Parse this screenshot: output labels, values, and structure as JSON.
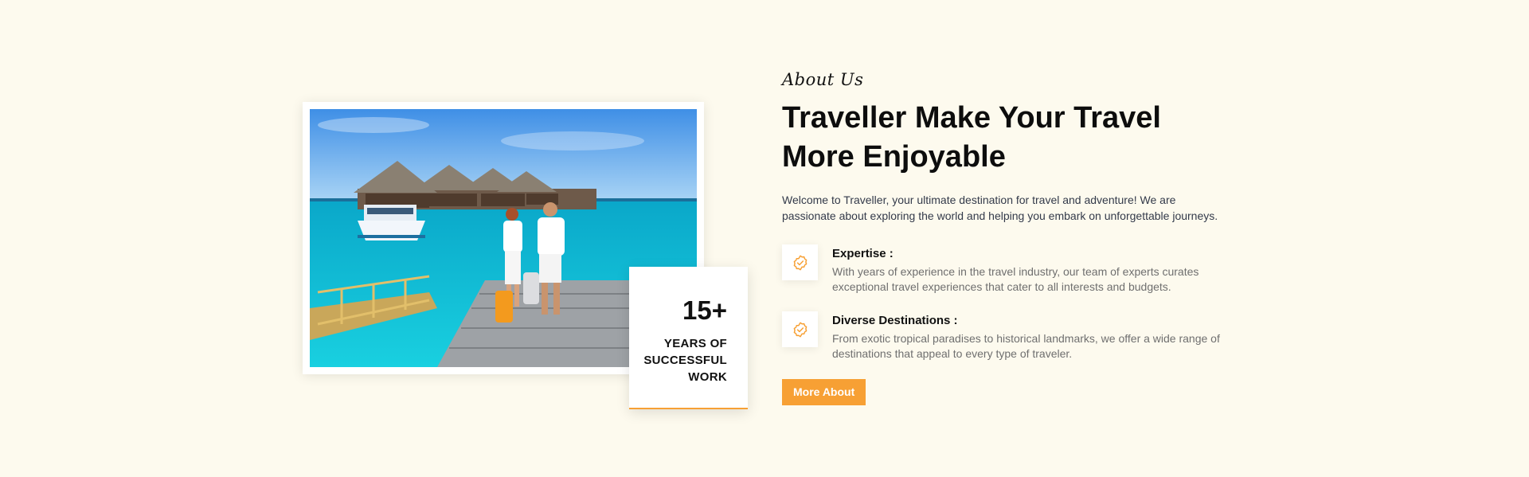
{
  "about": {
    "eyebrow": "About Us",
    "heading": "Traveller Make Your Travel More Enjoyable",
    "intro": "Welcome to Traveller, your ultimate destination for travel and adventure! We are passionate about exploring the world and helping you embark on unforgettable journeys.",
    "features": [
      {
        "icon": "badge-check-icon",
        "title": "Expertise :",
        "text": "With years of experience in the travel industry, our team of experts curates exceptional travel experiences that cater to all interests and budgets."
      },
      {
        "icon": "badge-check-icon",
        "title": "Diverse Destinations :",
        "text": "From exotic tropical paradises to historical landmarks, we offer a wide range of destinations that appeal to every type of traveler."
      }
    ],
    "button_label": "More About"
  },
  "stat": {
    "number": "15+",
    "label": "YEARS OF SUCCESSFUL WORK"
  },
  "colors": {
    "background": "#fdfaee",
    "accent": "#f7a034",
    "heading": "#0d0d0d",
    "body_text": "#6f6f6f"
  }
}
